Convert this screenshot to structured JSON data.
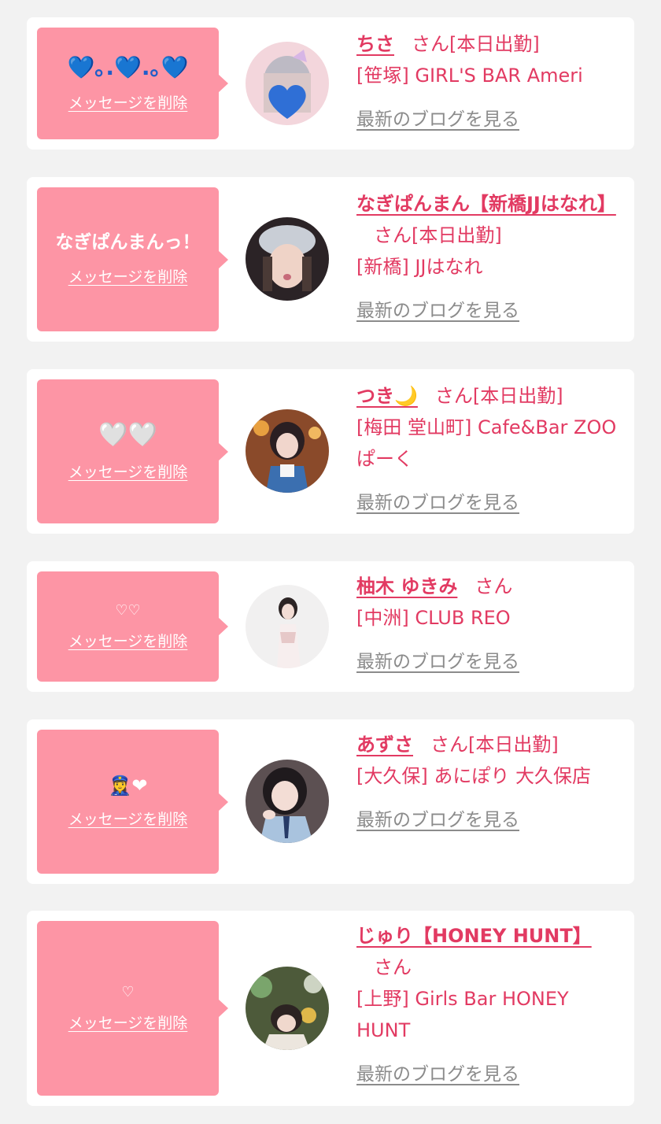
{
  "common": {
    "delete_label": "メッセージを削除",
    "blog_label": "最新のブログを見る"
  },
  "colors": {
    "accent": "#e23a62",
    "bubble": "#fd95a5",
    "muted": "#8b8b8b",
    "card": "#ffffff",
    "background": "#f2f2f2"
  },
  "cards": [
    {
      "message": "💙｡.💙.｡💙",
      "name": "ちさ",
      "suffix": "さん[本日出勤]",
      "shop": "[笹塚] GIRL'S BAR Ameri",
      "avatar_icon": "person-photo"
    },
    {
      "message": "なぎぱんまんっ！",
      "name": "なぎぱんまん【新橋JJはなれ】",
      "suffix": "さん[本日出勤]",
      "shop": "[新橋] JJはなれ",
      "avatar_icon": "person-photo"
    },
    {
      "message": "🤍🤍",
      "name": "つき🌙",
      "suffix": "さん[本日出勤]",
      "shop": "[梅田 堂山町] Cafe&Bar ZOOぱーく",
      "avatar_icon": "person-photo"
    },
    {
      "message": "♡♡",
      "name": "柚木 ゆきみ",
      "suffix": "さん",
      "shop": "[中洲] CLUB REO",
      "avatar_icon": "person-photo"
    },
    {
      "message": "👮‍♀️❤",
      "name": "あずさ",
      "suffix": "さん[本日出勤]",
      "shop": "[大久保] あにぽり 大久保店",
      "avatar_icon": "person-photo"
    },
    {
      "message": "♡",
      "name": "じゅり【HONEY HUNT】",
      "suffix": "さん",
      "shop": "[上野] Girls Bar HONEY HUNT",
      "avatar_icon": "person-photo"
    }
  ]
}
